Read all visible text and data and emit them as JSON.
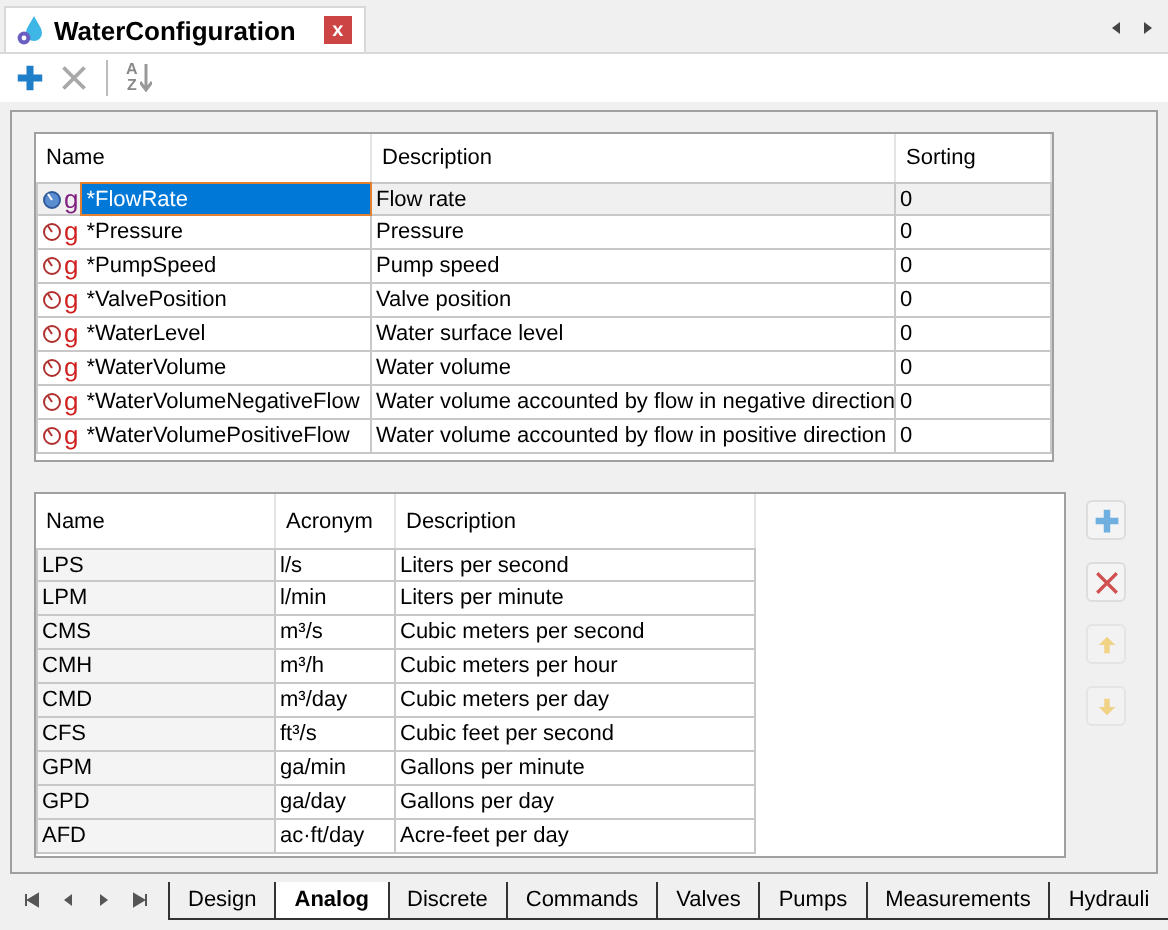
{
  "document_tab": {
    "title": "WaterConfiguration",
    "close": "x"
  },
  "toolbar": [
    {
      "kind": "add",
      "disabled": false
    },
    {
      "kind": "delete",
      "disabled": true
    },
    {
      "kind": "sort",
      "top": "A",
      "bottom": "Z",
      "disabled": false
    }
  ],
  "signals_table": {
    "columns": [
      "Name",
      "Description",
      "Sorting"
    ],
    "rows": [
      {
        "tag": "g",
        "name": "*FlowRate",
        "description": "Flow rate",
        "sorting": "0",
        "selected": true
      },
      {
        "tag": "g",
        "name": "*Pressure",
        "description": "Pressure",
        "sorting": "0",
        "selected": false
      },
      {
        "tag": "g",
        "name": "*PumpSpeed",
        "description": "Pump speed",
        "sorting": "0",
        "selected": false
      },
      {
        "tag": "g",
        "name": "*ValvePosition",
        "description": "Valve position",
        "sorting": "0",
        "selected": false
      },
      {
        "tag": "g",
        "name": "*WaterLevel",
        "description": "Water surface level",
        "sorting": "0",
        "selected": false
      },
      {
        "tag": "g",
        "name": "*WaterVolume",
        "description": "Water volume",
        "sorting": "0",
        "selected": false
      },
      {
        "tag": "g",
        "name": "*WaterVolumeNegativeFlow",
        "description": "Water volume accounted by flow in negative direction",
        "sorting": "0",
        "selected": false
      },
      {
        "tag": "g",
        "name": "*WaterVolumePositiveFlow",
        "description": "Water volume accounted by flow in positive direction",
        "sorting": "0",
        "selected": false
      }
    ]
  },
  "units_table": {
    "columns": [
      "Name",
      "Acronym",
      "Description"
    ],
    "rows": [
      {
        "name": "LPS",
        "acronym": "l/s",
        "description": "Liters per second"
      },
      {
        "name": "LPM",
        "acronym": "l/min",
        "description": "Liters per minute"
      },
      {
        "name": "CMS",
        "acronym": "m³/s",
        "description": "Cubic meters per second"
      },
      {
        "name": "CMH",
        "acronym": "m³/h",
        "description": "Cubic meters per hour"
      },
      {
        "name": "CMD",
        "acronym": "m³/day",
        "description": "Cubic meters per day"
      },
      {
        "name": "CFS",
        "acronym": "ft³/s",
        "description": "Cubic feet per second"
      },
      {
        "name": "GPM",
        "acronym": "ga/min",
        "description": "Gallons per minute"
      },
      {
        "name": "GPD",
        "acronym": "ga/day",
        "description": "Gallons per day"
      },
      {
        "name": "AFD",
        "acronym": "ac·ft/day",
        "description": "Acre-feet per day"
      }
    ]
  },
  "side_buttons": [
    {
      "kind": "add",
      "disabled": false
    },
    {
      "kind": "delete",
      "disabled": false
    },
    {
      "kind": "up",
      "disabled": true
    },
    {
      "kind": "down",
      "disabled": true
    }
  ],
  "sheet_tabs": [
    {
      "label": "Design",
      "selected": false
    },
    {
      "label": "Analog",
      "selected": true
    },
    {
      "label": "Discrete",
      "selected": false
    },
    {
      "label": "Commands",
      "selected": false
    },
    {
      "label": "Valves",
      "selected": false
    },
    {
      "label": "Pumps",
      "selected": false
    },
    {
      "label": "Measurements",
      "selected": false
    },
    {
      "label": "Hydrauli",
      "selected": false
    }
  ]
}
